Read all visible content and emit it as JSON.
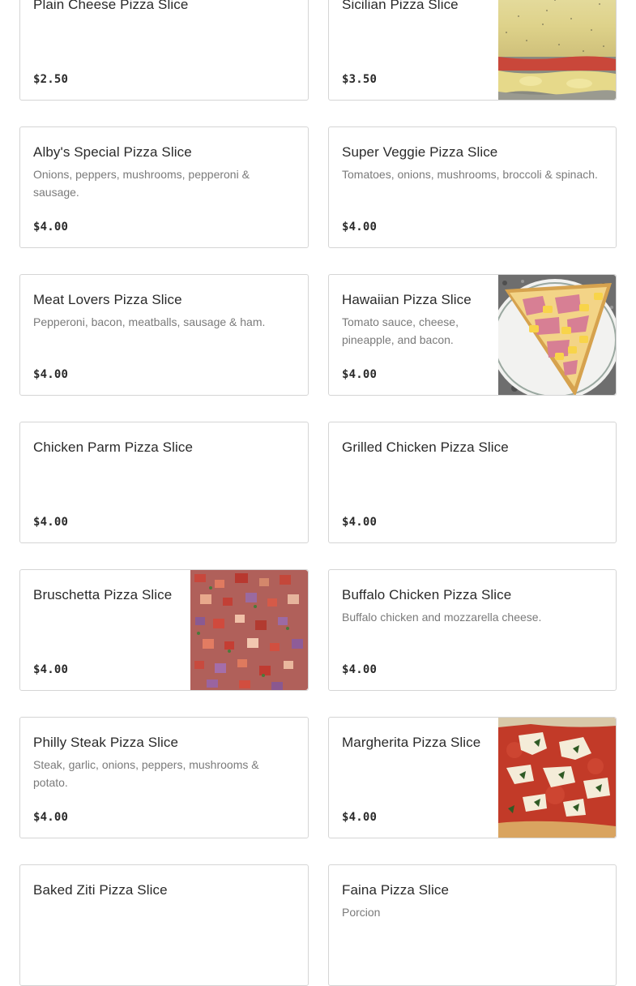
{
  "menu": {
    "items": [
      {
        "name": "Plain Cheese Pizza Slice",
        "description": "",
        "price": "$2.50",
        "image": null
      },
      {
        "name": "Sicilian Pizza Slice",
        "description": "",
        "price": "$3.50",
        "image": "sicilian-pizza-photo"
      },
      {
        "name": "Alby's Special Pizza Slice",
        "description": "Onions, peppers, mushrooms, pepperoni & sausage.",
        "price": "$4.00",
        "image": null
      },
      {
        "name": "Super Veggie Pizza Slice",
        "description": "Tomatoes, onions, mushrooms, broccoli & spinach.",
        "price": "$4.00",
        "image": null
      },
      {
        "name": "Meat Lovers Pizza Slice",
        "description": "Pepperoni, bacon, meatballs, sausage & ham.",
        "price": "$4.00",
        "image": null
      },
      {
        "name": "Hawaiian Pizza Slice",
        "description": "Tomato sauce, cheese, pineapple, and bacon.",
        "price": "$4.00",
        "image": "hawaiian-pizza-photo"
      },
      {
        "name": "Chicken Parm Pizza Slice",
        "description": "",
        "price": "$4.00",
        "image": null
      },
      {
        "name": "Grilled Chicken Pizza Slice",
        "description": "",
        "price": "$4.00",
        "image": null
      },
      {
        "name": "Bruschetta Pizza Slice",
        "description": "",
        "price": "$4.00",
        "image": "bruschetta-pizza-photo"
      },
      {
        "name": "Buffalo Chicken Pizza Slice",
        "description": "Buffalo chicken and mozzarella cheese.",
        "price": "$4.00",
        "image": null
      },
      {
        "name": "Philly Steak Pizza Slice",
        "description": "Steak, garlic, onions, peppers, mushrooms & potato.",
        "price": "$4.00",
        "image": null
      },
      {
        "name": "Margherita Pizza Slice",
        "description": "",
        "price": "$4.00",
        "image": "margherita-pizza-photo"
      },
      {
        "name": "Baked Ziti Pizza Slice",
        "description": "",
        "price": "",
        "image": null
      },
      {
        "name": "Faina Pizza Slice",
        "description": "Porcion",
        "price": "",
        "image": null
      }
    ]
  }
}
